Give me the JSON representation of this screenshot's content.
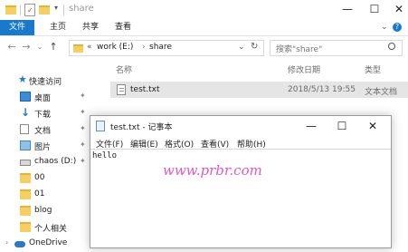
{
  "explorer": {
    "title": "share",
    "ribbon_tabs": [
      "文件",
      "主页",
      "共享",
      "查看"
    ],
    "breadcrumb": {
      "prefix": "«",
      "drive": "work (E:)",
      "separator": "›",
      "folder": "share"
    },
    "search_placeholder": "搜索\"share\"",
    "columns": {
      "name": "名称",
      "modified": "修改日期",
      "type": "类型"
    },
    "file": {
      "name": "test.txt",
      "modified": "2018/5/13 19:55",
      "type": "文本文档"
    }
  },
  "nav": {
    "quick_access": "快速访问",
    "items": [
      {
        "label": "桌面",
        "icon": "desktop-icon",
        "pinned": true
      },
      {
        "label": "下载",
        "icon": "download-icon",
        "pinned": true
      },
      {
        "label": "文档",
        "icon": "document-icon",
        "pinned": true
      },
      {
        "label": "图片",
        "icon": "pictures-icon",
        "pinned": true
      },
      {
        "label": "chaos (D:)",
        "icon": "drive-icon",
        "pinned": true
      },
      {
        "label": "00",
        "icon": "folder-icon",
        "pinned": false
      },
      {
        "label": "01",
        "icon": "folder-icon",
        "pinned": false
      },
      {
        "label": "blog",
        "icon": "folder-icon",
        "pinned": false
      },
      {
        "label": "个人相关",
        "icon": "folder-icon",
        "pinned": false
      },
      {
        "label": "OneDrive",
        "icon": "onedrive-icon",
        "pinned": false
      }
    ],
    "pin_glyph": "✦"
  },
  "notepad": {
    "title": "test.txt - 记事本",
    "menu": [
      "文件(F)",
      "编辑(E)",
      "格式(O)",
      "查看(V)",
      "帮助(H)"
    ],
    "content": "hello"
  },
  "watermark": "www.prbr.com",
  "colors": {
    "accent": "#1979ca",
    "selection": "#e5e5e5",
    "watermark": "#e657c3"
  }
}
